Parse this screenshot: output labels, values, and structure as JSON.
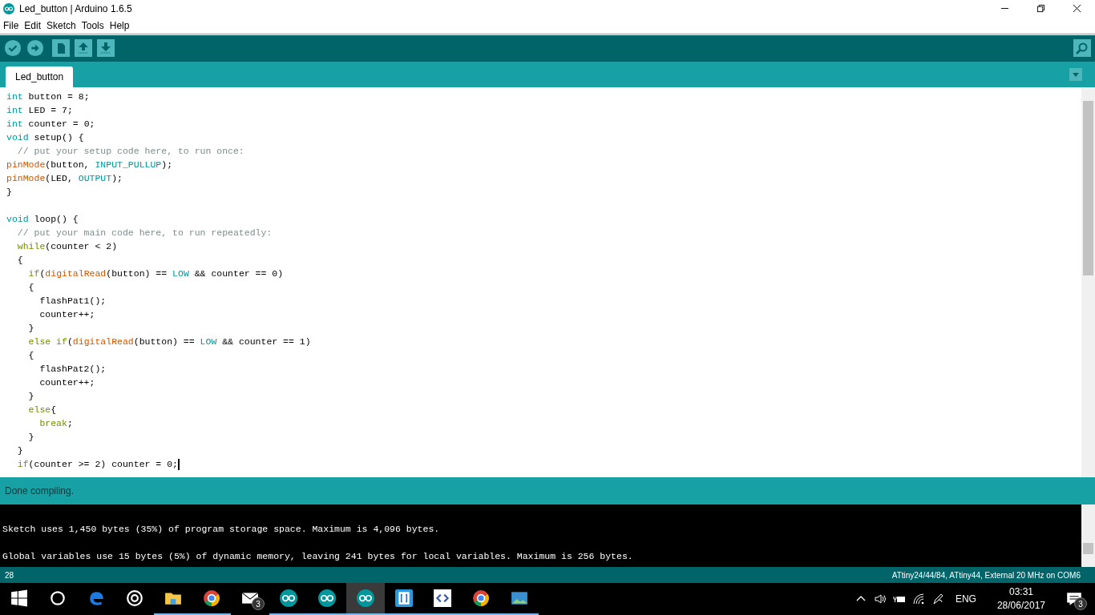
{
  "window": {
    "title": "Led_button | Arduino 1.6.5"
  },
  "menu": [
    "File",
    "Edit",
    "Sketch",
    "Tools",
    "Help"
  ],
  "toolbar": [
    {
      "kind": "verify"
    },
    {
      "kind": "upload"
    },
    {
      "kind": "new"
    },
    {
      "kind": "open"
    },
    {
      "kind": "save"
    }
  ],
  "tabs": [
    {
      "label": "Led_button",
      "selected": true
    }
  ],
  "editor": {
    "lines": [
      {
        "kind": "code",
        "tokens": [
          {
            "text": "int",
            "kind": "type"
          },
          {
            "text": " button = 8;",
            "kind": "plain"
          }
        ]
      },
      {
        "kind": "code",
        "tokens": [
          {
            "text": "int",
            "kind": "type"
          },
          {
            "text": " LED = 7;",
            "kind": "plain"
          }
        ]
      },
      {
        "kind": "code",
        "tokens": [
          {
            "text": "int",
            "kind": "type"
          },
          {
            "text": " counter = 0;",
            "kind": "plain"
          }
        ]
      },
      {
        "kind": "code",
        "tokens": [
          {
            "text": "void",
            "kind": "type"
          },
          {
            "text": " setup() {",
            "kind": "plain"
          }
        ]
      },
      {
        "kind": "code",
        "tokens": [
          {
            "text": "  // put your setup code here, to run once:",
            "kind": "comment"
          }
        ]
      },
      {
        "kind": "code",
        "tokens": [
          {
            "text": "pinMode",
            "kind": "function"
          },
          {
            "text": "(button, ",
            "kind": "plain"
          },
          {
            "text": "INPUT_PULLUP",
            "kind": "type"
          },
          {
            "text": ");",
            "kind": "plain"
          }
        ]
      },
      {
        "kind": "code",
        "tokens": [
          {
            "text": "pinMode",
            "kind": "function"
          },
          {
            "text": "(LED, ",
            "kind": "plain"
          },
          {
            "text": "OUTPUT",
            "kind": "type"
          },
          {
            "text": ");",
            "kind": "plain"
          }
        ]
      },
      {
        "kind": "code",
        "tokens": [
          {
            "text": "}",
            "kind": "plain"
          }
        ]
      },
      {
        "kind": "blank"
      },
      {
        "kind": "code",
        "tokens": [
          {
            "text": "void",
            "kind": "type"
          },
          {
            "text": " loop() {",
            "kind": "plain"
          }
        ]
      },
      {
        "kind": "code",
        "tokens": [
          {
            "text": "  // put your main code here, to run repeatedly:",
            "kind": "comment"
          }
        ]
      },
      {
        "kind": "code",
        "tokens": [
          {
            "text": "  while",
            "kind": "control"
          },
          {
            "text": "(counter < 2)",
            "kind": "plain"
          }
        ]
      },
      {
        "kind": "code",
        "tokens": [
          {
            "text": "  {",
            "kind": "plain"
          }
        ]
      },
      {
        "kind": "code",
        "tokens": [
          {
            "text": "    if",
            "kind": "control"
          },
          {
            "text": "(",
            "kind": "plain"
          },
          {
            "text": "digitalRead",
            "kind": "function"
          },
          {
            "text": "(button) == ",
            "kind": "plain"
          },
          {
            "text": "LOW",
            "kind": "type"
          },
          {
            "text": " && counter == 0)",
            "kind": "plain"
          }
        ]
      },
      {
        "kind": "code",
        "tokens": [
          {
            "text": "    {",
            "kind": "plain"
          }
        ]
      },
      {
        "kind": "code",
        "tokens": [
          {
            "text": "      flashPat1();",
            "kind": "plain"
          }
        ]
      },
      {
        "kind": "code",
        "tokens": [
          {
            "text": "      counter++;",
            "kind": "plain"
          }
        ]
      },
      {
        "kind": "code",
        "tokens": [
          {
            "text": "    }",
            "kind": "plain"
          }
        ]
      },
      {
        "kind": "code",
        "tokens": [
          {
            "text": "    else if",
            "kind": "control"
          },
          {
            "text": "(",
            "kind": "plain"
          },
          {
            "text": "digitalRead",
            "kind": "function"
          },
          {
            "text": "(button) == ",
            "kind": "plain"
          },
          {
            "text": "LOW",
            "kind": "type"
          },
          {
            "text": " && counter == 1)",
            "kind": "plain"
          }
        ]
      },
      {
        "kind": "code",
        "tokens": [
          {
            "text": "    {",
            "kind": "plain"
          }
        ]
      },
      {
        "kind": "code",
        "tokens": [
          {
            "text": "      flashPat2();",
            "kind": "plain"
          }
        ]
      },
      {
        "kind": "code",
        "tokens": [
          {
            "text": "      counter++;",
            "kind": "plain"
          }
        ]
      },
      {
        "kind": "code",
        "tokens": [
          {
            "text": "    }",
            "kind": "plain"
          }
        ]
      },
      {
        "kind": "code",
        "tokens": [
          {
            "text": "    else",
            "kind": "control"
          },
          {
            "text": "{",
            "kind": "plain"
          }
        ]
      },
      {
        "kind": "code",
        "tokens": [
          {
            "text": "      break",
            "kind": "control"
          },
          {
            "text": ";",
            "kind": "plain"
          }
        ]
      },
      {
        "kind": "code",
        "tokens": [
          {
            "text": "    }",
            "kind": "plain"
          }
        ]
      },
      {
        "kind": "code",
        "tokens": [
          {
            "text": "  }",
            "kind": "plain"
          }
        ]
      },
      {
        "kind": "code",
        "tokens": [
          {
            "text": "  if",
            "kind": "control"
          },
          {
            "text": "(counter >= 2) counter = 0;",
            "kind": "plain"
          }
        ]
      }
    ]
  },
  "status": {
    "message": "Done compiling."
  },
  "console": {
    "lines": [
      "Sketch uses 1,450 bytes (35%) of program storage space. Maximum is 4,096 bytes.",
      "Global variables use 15 bytes (5%) of dynamic memory, leaving 241 bytes for local variables. Maximum is 256 bytes."
    ]
  },
  "status_bar": {
    "line": "28",
    "board": "ATtiny24/44/84, ATtiny44, External 20 MHz on COM6"
  },
  "taskbar": {
    "apps": [
      {
        "kind": "start",
        "open": false,
        "selected": false
      },
      {
        "kind": "search",
        "open": false,
        "selected": false
      },
      {
        "kind": "edge",
        "open": false,
        "selected": false
      },
      {
        "kind": "groove",
        "open": false,
        "selected": false
      },
      {
        "kind": "folder",
        "open": true,
        "selected": false
      },
      {
        "kind": "chrome",
        "open": true,
        "selected": false
      },
      {
        "kind": "mail",
        "open": false,
        "selected": false,
        "badge": "3"
      },
      {
        "kind": "arduino",
        "open": true,
        "selected": false
      },
      {
        "kind": "arduino",
        "open": true,
        "selected": false
      },
      {
        "kind": "arduino",
        "open": true,
        "selected": true
      },
      {
        "kind": "brackets",
        "open": true,
        "selected": false
      },
      {
        "kind": "code",
        "open": true,
        "selected": false
      },
      {
        "kind": "chrome",
        "open": true,
        "selected": false
      },
      {
        "kind": "photos",
        "open": true,
        "selected": false
      }
    ],
    "language": "ENG",
    "time": "03:31",
    "date": "28/06/2017",
    "notifications": "3"
  }
}
